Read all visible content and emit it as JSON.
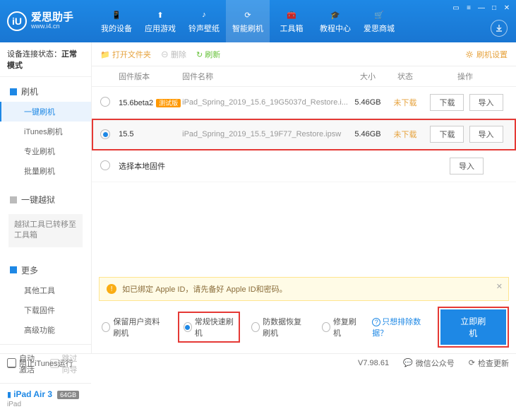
{
  "app": {
    "name": "爱思助手",
    "url": "www.i4.cn",
    "logo_letter": "iU"
  },
  "window_controls": [
    "▭",
    "≡",
    "—",
    "□",
    "✕"
  ],
  "topnav": [
    {
      "label": "我的设备"
    },
    {
      "label": "应用游戏"
    },
    {
      "label": "铃声壁纸"
    },
    {
      "label": "智能刷机",
      "active": true
    },
    {
      "label": "工具箱"
    },
    {
      "label": "教程中心"
    },
    {
      "label": "爱思商城"
    }
  ],
  "sidebar": {
    "status_label": "设备连接状态：",
    "status_value": "正常模式",
    "groups": [
      {
        "head": "刷机",
        "items": [
          {
            "label": "一键刷机",
            "active": true
          },
          {
            "label": "iTunes刷机"
          },
          {
            "label": "专业刷机"
          },
          {
            "label": "批量刷机"
          }
        ]
      },
      {
        "head": "一键越狱",
        "gray": true,
        "note": "越狱工具已转移至工具箱"
      },
      {
        "head": "更多",
        "items": [
          {
            "label": "其他工具"
          },
          {
            "label": "下载固件"
          },
          {
            "label": "高级功能"
          }
        ]
      }
    ],
    "checks": {
      "auto_activate": "自动激活",
      "skip_guide": "跳过向导"
    },
    "device": {
      "name": "iPad Air 3",
      "storage": "64GB",
      "type": "iPad"
    }
  },
  "toolbar": {
    "open_folder": "打开文件夹",
    "delete": "删除",
    "refresh": "刷新",
    "settings": "刷机设置"
  },
  "columns": {
    "version": "固件版本",
    "name": "固件名称",
    "size": "大小",
    "status": "状态",
    "ops": "操作"
  },
  "firmware": [
    {
      "version": "15.6beta2",
      "beta": "测试版",
      "name": "iPad_Spring_2019_15.6_19G5037d_Restore.i...",
      "size": "5.46GB",
      "status": "未下载",
      "selected": false
    },
    {
      "version": "15.5",
      "name": "iPad_Spring_2019_15.5_19F77_Restore.ipsw",
      "size": "5.46GB",
      "status": "未下载",
      "selected": true
    }
  ],
  "local_firmware": "选择本地固件",
  "buttons": {
    "download": "下载",
    "import": "导入"
  },
  "warning": "如已绑定 Apple ID，请先备好 Apple ID和密码。",
  "flash_options": [
    {
      "label": "保留用户资料刷机"
    },
    {
      "label": "常规快速刷机",
      "selected": true,
      "highlight": true
    },
    {
      "label": "防数据恢复刷机"
    },
    {
      "label": "修复刷机"
    }
  ],
  "exclude_link": "只想排除数据？",
  "flash_now": "立即刷机",
  "statusbar": {
    "block_itunes": "阻止iTunes运行",
    "version": "V7.98.61",
    "wechat": "微信公众号",
    "check_update": "检查更新"
  }
}
